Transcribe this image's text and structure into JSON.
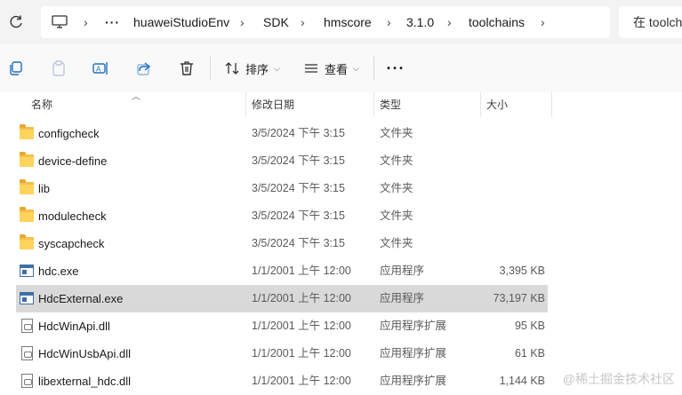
{
  "address_bar": {
    "breadcrumb": [
      "huaweiStudioEnv",
      "SDK",
      "hmscore",
      "3.1.0",
      "toolchains"
    ],
    "ellipsis": "···",
    "search_placeholder": "在 toolch"
  },
  "command_bar": {
    "sort_label": "排序",
    "view_label": "查看",
    "more_label": "···"
  },
  "columns": {
    "name": "名称",
    "date": "修改日期",
    "type": "类型",
    "size": "大小"
  },
  "files": [
    {
      "name": "configcheck",
      "date": "3/5/2024 下午 3:15",
      "type": "文件夹",
      "size": "",
      "icon": "folder-icon"
    },
    {
      "name": "device-define",
      "date": "3/5/2024 下午 3:15",
      "type": "文件夹",
      "size": "",
      "icon": "folder-icon"
    },
    {
      "name": "lib",
      "date": "3/5/2024 下午 3:15",
      "type": "文件夹",
      "size": "",
      "icon": "folder-icon"
    },
    {
      "name": "modulecheck",
      "date": "3/5/2024 下午 3:15",
      "type": "文件夹",
      "size": "",
      "icon": "folder-icon"
    },
    {
      "name": "syscapcheck",
      "date": "3/5/2024 下午 3:15",
      "type": "文件夹",
      "size": "",
      "icon": "folder-icon"
    },
    {
      "name": "hdc.exe",
      "date": "1/1/2001 上午 12:00",
      "type": "应用程序",
      "size": "3,395 KB",
      "icon": "exe-icon"
    },
    {
      "name": "HdcExternal.exe",
      "date": "1/1/2001 上午 12:00",
      "type": "应用程序",
      "size": "73,197 KB",
      "icon": "exe-icon",
      "selected": true
    },
    {
      "name": "HdcWinApi.dll",
      "date": "1/1/2001 上午 12:00",
      "type": "应用程序扩展",
      "size": "95 KB",
      "icon": "dll-icon"
    },
    {
      "name": "HdcWinUsbApi.dll",
      "date": "1/1/2001 上午 12:00",
      "type": "应用程序扩展",
      "size": "61 KB",
      "icon": "dll-icon"
    },
    {
      "name": "libexternal_hdc.dll",
      "date": "1/1/2001 上午 12:00",
      "type": "应用程序扩展",
      "size": "1,144 KB",
      "icon": "dll-icon"
    }
  ],
  "watermark": "@稀土掘金技术社区",
  "colors": {
    "selection": "#d9d9d9",
    "folder": "#f4c04b",
    "accent": "#1f6fc5"
  }
}
